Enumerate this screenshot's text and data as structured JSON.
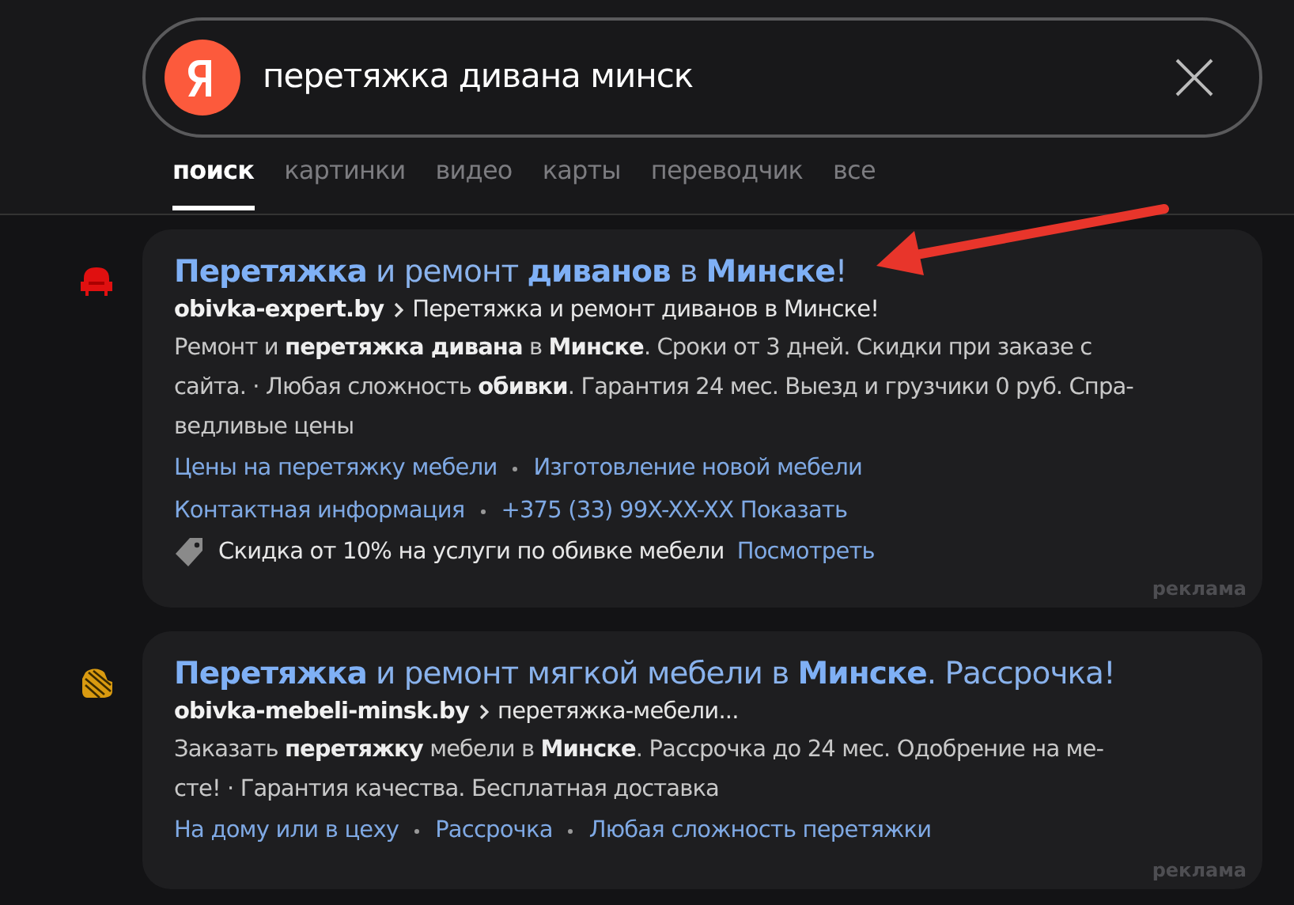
{
  "search": {
    "query": "перетяжка дивана минск"
  },
  "tabs": [
    {
      "label": "поиск",
      "selected": true
    },
    {
      "label": "картинки",
      "selected": false
    },
    {
      "label": "видео",
      "selected": false
    },
    {
      "label": "карты",
      "selected": false
    },
    {
      "label": "переводчик",
      "selected": false
    },
    {
      "label": "все",
      "selected": false
    }
  ],
  "results": [
    {
      "favicon": {
        "kind": "armchair"
      },
      "title": "**Перетяжка** и ремонт **диванов** в **Минске**!",
      "domain": "obivka-expert.by",
      "path": "Перетяжка и ремонт диванов в Минске!",
      "description_lines": [
        "Ремонт и **перетяжка дивана** в **Минске**. Сроки от 3 дней. Скидки при заказе с",
        "сайта. · Любая сложность **обивки**. Гарантия 24 мес. Выезд и грузчики 0 руб. Спра-",
        "ведливые цены"
      ],
      "sitelink_rows": [
        [
          "Цены на перетяжку мебели",
          "Изготовление новой мебели"
        ],
        [
          "Контактная информация",
          "+375 (33) 99X-XX-XX Показать"
        ]
      ],
      "offer": {
        "text": "Скидка от 10% на услуги по обивке мебели",
        "link": "Посмотреть"
      },
      "ad_label": "реклама"
    },
    {
      "favicon": {
        "kind": "stripes"
      },
      "title": "**Перетяжка** и ремонт мягкой мебели в **Минске**. Рассрочка!",
      "domain": "obivka-mebeli-minsk.by",
      "path": "перетяжка-мебели...",
      "description_lines": [
        "Заказать **перетяжку** мебели в **Минске**. Рассрочка до 24 мес. Одобрение на ме-",
        "сте! · Гарантия качества. Бесплатная доставка"
      ],
      "sitelink_rows": [
        [
          "На дому или в цеху",
          "Рассрочка",
          "Любая сложность перетяжки"
        ]
      ],
      "ad_label": "реклама"
    }
  ]
}
